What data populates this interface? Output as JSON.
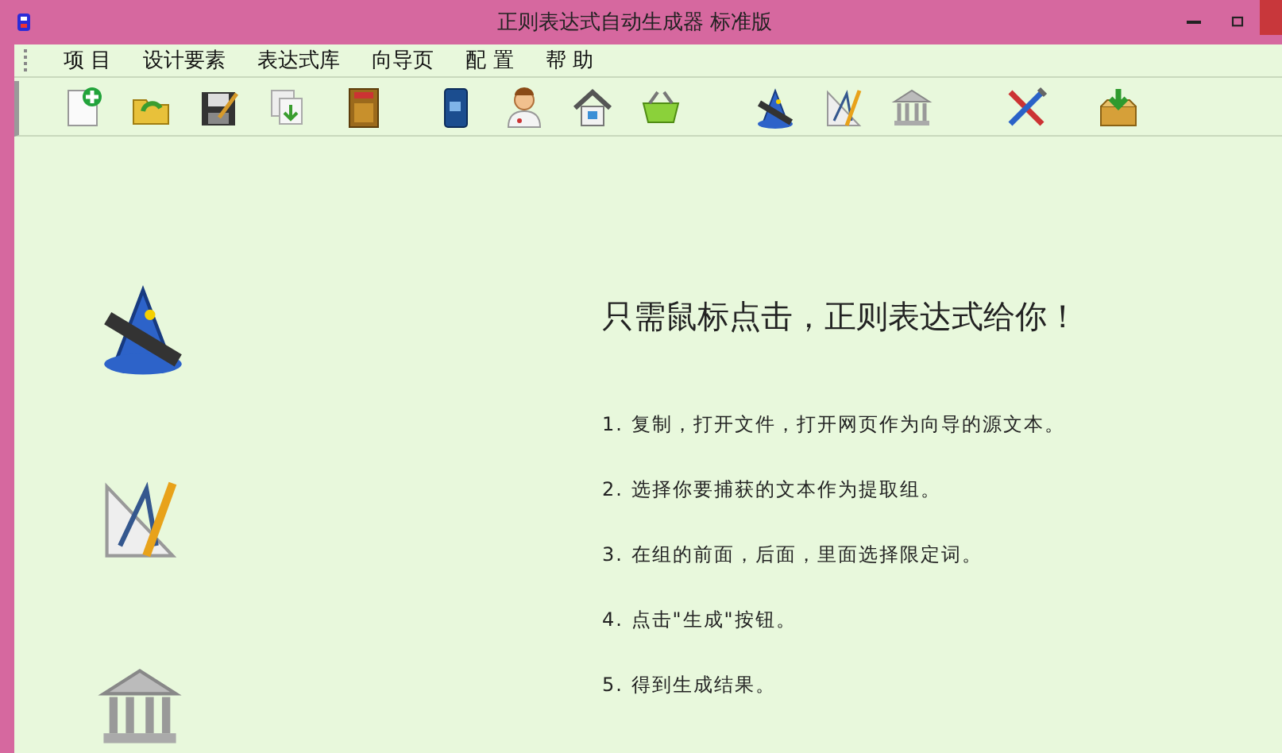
{
  "window": {
    "title": "正则表达式自动生成器 标准版"
  },
  "menu": [
    "项 目",
    "设计要素",
    "表达式库",
    "向导页",
    "配 置",
    "帮 助"
  ],
  "content": {
    "heading": "只需鼠标点击，正则表达式给你！",
    "steps": [
      "1. 复制，打开文件，打开网页作为向导的源文本。",
      "2. 选择你要捕获的文本作为提取组。",
      "3. 在组的前面，后面，里面选择限定词。",
      "4. 点击\"生成\"按钮。",
      "5. 得到生成结果。"
    ]
  }
}
